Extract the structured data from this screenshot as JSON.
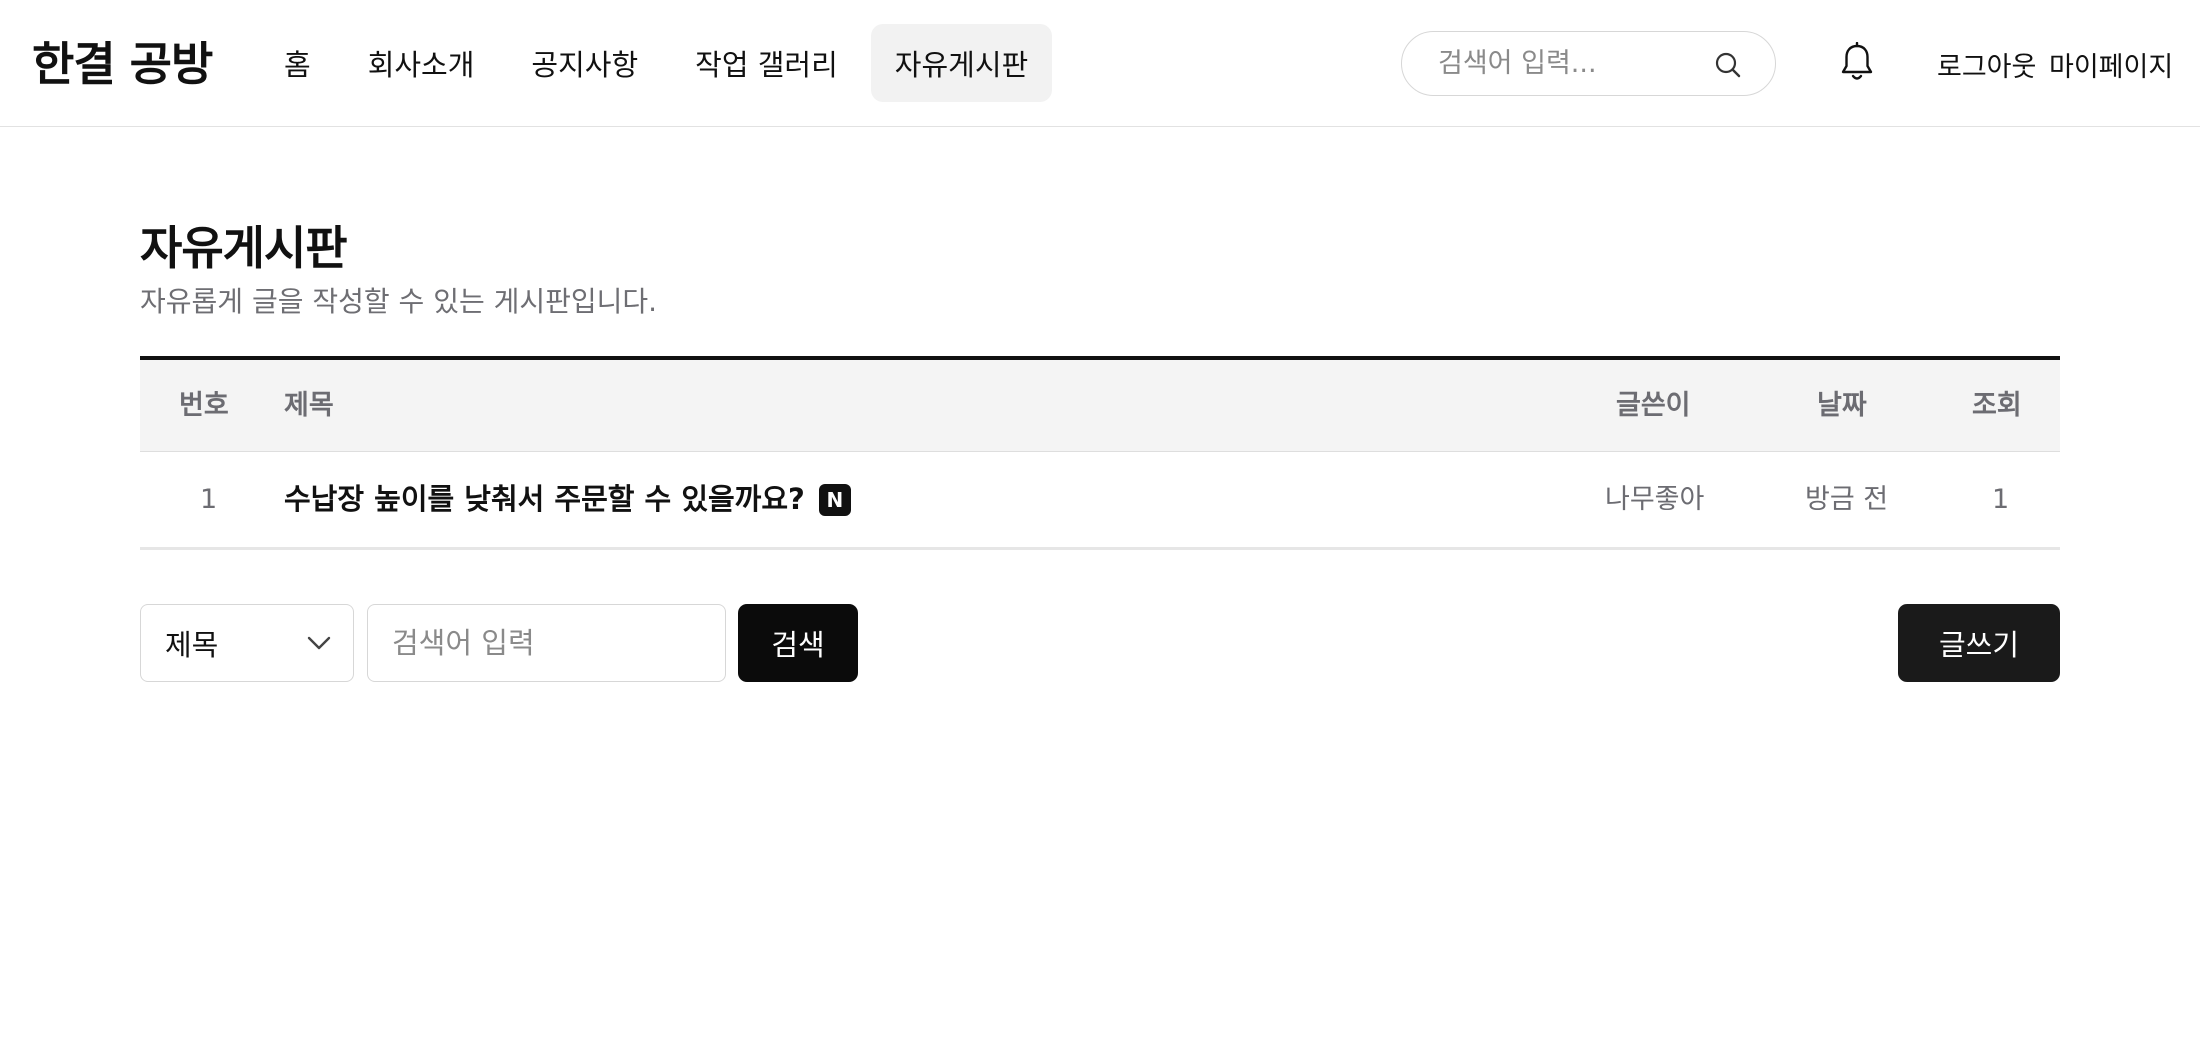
{
  "header": {
    "logo": "한결 공방",
    "nav": [
      {
        "label": "홈",
        "active": false
      },
      {
        "label": "회사소개",
        "active": false
      },
      {
        "label": "공지사항",
        "active": false
      },
      {
        "label": "작업 갤러리",
        "active": false
      },
      {
        "label": "자유게시판",
        "active": true
      }
    ],
    "search_placeholder": "검색어 입력...",
    "search_icon": "search-icon",
    "notification_icon": "bell-icon",
    "logout_label": "로그아웃",
    "mypage_label": "마이페이지"
  },
  "board": {
    "title": "자유게시판",
    "subtitle": "자유롭게 글을 작성할 수 있는 게시판입니다.",
    "columns": {
      "no": "번호",
      "title": "제목",
      "author": "글쓴이",
      "date": "날짜",
      "views": "조회"
    },
    "rows": [
      {
        "no": "1",
        "title": "수납장 높이를 낮춰서 주문할 수 있을까요?",
        "badge": "N",
        "author": "나무좋아",
        "date": "방금 전",
        "views": "1"
      }
    ]
  },
  "controls": {
    "filter_selected": "제목",
    "search_placeholder": "검색어 입력",
    "search_button": "검색",
    "write_button": "글쓰기"
  }
}
